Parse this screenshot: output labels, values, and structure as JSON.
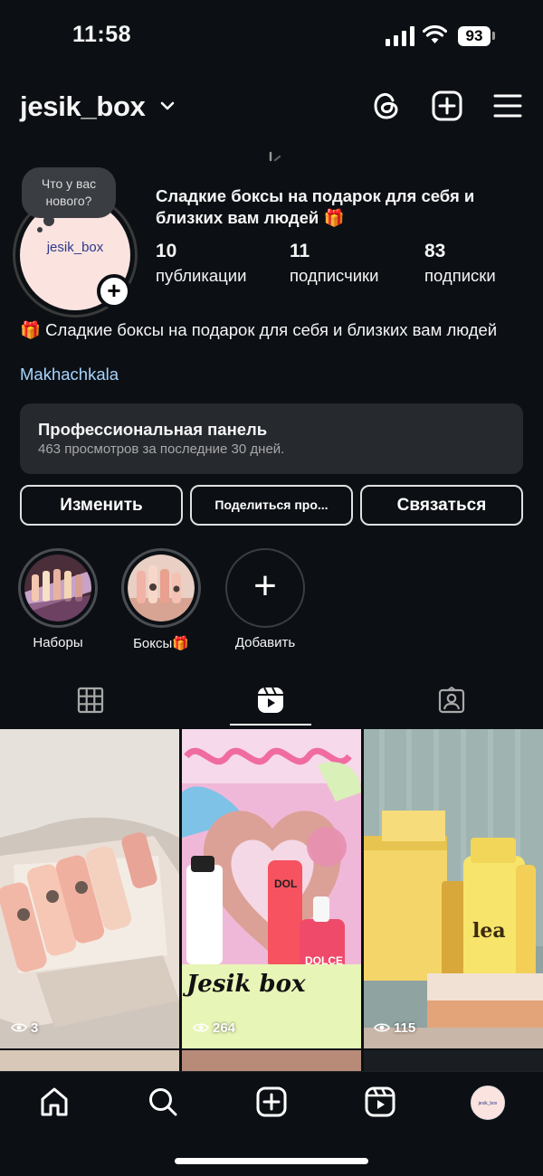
{
  "status_bar": {
    "time": "11:58",
    "battery": "93"
  },
  "header": {
    "username": "jesik_box"
  },
  "profile": {
    "avatar_text": "jesik_box",
    "note": "Что у вас нового?",
    "bio_title": "Сладкие боксы на подарок для себя и близких вам людей 🎁",
    "stats": [
      {
        "value": "10",
        "label": "публикации"
      },
      {
        "value": "11",
        "label": "подписчики"
      },
      {
        "value": "83",
        "label": "подписки"
      }
    ],
    "bio_text": "🎁 Сладкие боксы на подарок для себя и близких вам людей",
    "location": "Makhachkala"
  },
  "pro_panel": {
    "title": "Профессиональная панель",
    "subtitle": "463 просмотров за последние 30 дней."
  },
  "buttons": {
    "edit": "Изменить",
    "share": "Поделиться про...",
    "contact": "Связаться"
  },
  "highlights": [
    {
      "label": "Наборы"
    },
    {
      "label": "Боксы🎁"
    },
    {
      "label": "Добавить"
    }
  ],
  "grid": [
    {
      "views": "3"
    },
    {
      "views": "264",
      "overlay_text": "Jesik box"
    },
    {
      "views": "115"
    }
  ],
  "nav": {
    "avatar_text": "jesik_box"
  },
  "colors": {
    "background": "#0c1014",
    "link": "#a7d4ff",
    "panel": "#26292e"
  }
}
